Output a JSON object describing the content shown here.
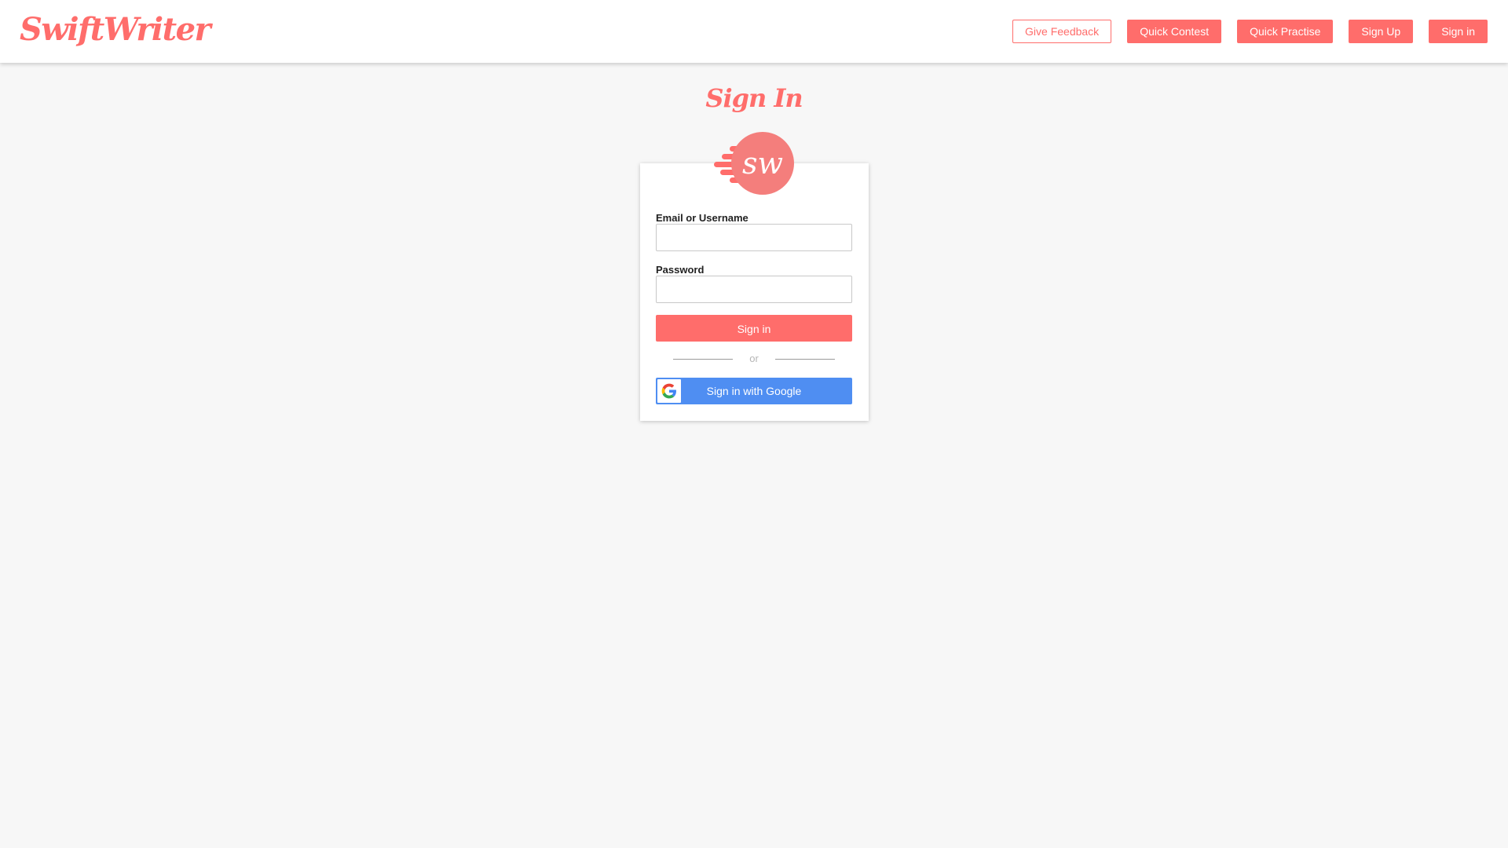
{
  "header": {
    "logo_text": "SwiftWriter",
    "nav": [
      {
        "label": "Give Feedback",
        "style": "outline"
      },
      {
        "label": "Quick Contest",
        "style": "filled"
      },
      {
        "label": "Quick Practise",
        "style": "filled"
      },
      {
        "label": "Sign Up",
        "style": "filled"
      },
      {
        "label": "Sign in",
        "style": "filled"
      }
    ]
  },
  "main": {
    "title": "Sign In",
    "badge_text": "sw",
    "form": {
      "email_label": "Email or Username",
      "email_value": "",
      "password_label": "Password",
      "password_value": "",
      "submit_label": "Sign in",
      "divider_text": "or",
      "google_label": "Sign in with Google"
    }
  },
  "colors": {
    "brand": "#ff6d6b",
    "google_blue": "#4f8ef2",
    "background": "#f7f7f7"
  },
  "icons": {
    "badge": "sw-logo-badge",
    "google": "google-g-icon"
  }
}
